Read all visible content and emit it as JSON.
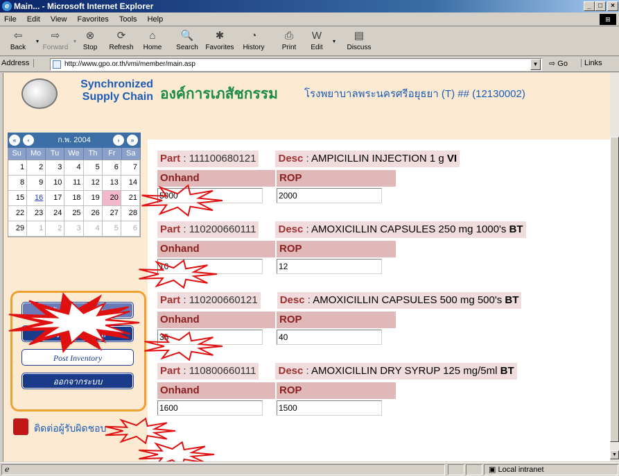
{
  "window": {
    "title": "Main... - Microsoft Internet Explorer",
    "controls": [
      "_",
      "□",
      "×"
    ]
  },
  "menubar": [
    "File",
    "Edit",
    "View",
    "Favorites",
    "Tools",
    "Help"
  ],
  "toolbar": [
    {
      "label": "Back",
      "icon": "back-arrow-icon",
      "glyph": "⇦"
    },
    {
      "label": "Forward",
      "icon": "forward-arrow-icon",
      "glyph": "⇨"
    },
    {
      "label": "Stop",
      "icon": "stop-icon",
      "glyph": "⊗"
    },
    {
      "label": "Refresh",
      "icon": "refresh-icon",
      "glyph": "⟳"
    },
    {
      "label": "Home",
      "icon": "home-icon",
      "glyph": "⌂"
    },
    {
      "label": "Search",
      "icon": "search-icon",
      "glyph": "🔍"
    },
    {
      "label": "Favorites",
      "icon": "favorites-icon",
      "glyph": "✱"
    },
    {
      "label": "History",
      "icon": "history-icon",
      "glyph": "◔"
    },
    {
      "label": "Print",
      "icon": "print-icon",
      "glyph": "⎙"
    },
    {
      "label": "Edit",
      "icon": "edit-icon",
      "glyph": "W"
    },
    {
      "label": "Discuss",
      "icon": "discuss-icon",
      "glyph": "▤"
    }
  ],
  "address": {
    "label": "Address",
    "url": "http://www.gpo.or.th/vmi/member/main.asp",
    "go": "Go",
    "links": "Links"
  },
  "header": {
    "logo_line1": "Synchronized",
    "logo_line2": "Supply Chain",
    "org": "องค์การเภสัชกรรม",
    "hospital": "โรงพยาบาลพระนครศรีอยุธยา (T) ## (12130002)"
  },
  "calendar": {
    "month_label": "ก.พ. 2004",
    "day_headers": [
      "Su",
      "Mo",
      "Tu",
      "We",
      "Th",
      "Fr",
      "Sa"
    ],
    "days": [
      "1",
      "2",
      "3",
      "4",
      "5",
      "6",
      "7",
      "8",
      "9",
      "10",
      "11",
      "12",
      "13",
      "14",
      "15",
      "16",
      "17",
      "18",
      "19",
      "20",
      "21",
      "22",
      "23",
      "24",
      "25",
      "26",
      "27",
      "28",
      "29",
      "1",
      "2",
      "3",
      "4",
      "5",
      "6"
    ],
    "today": "16",
    "highlight": "20"
  },
  "menu": {
    "items": [
      {
        "label": "บันทึก Inventory"
      },
      {
        "label": "ตรวจสอบข้อมูล"
      },
      {
        "label": "Post Inventory"
      },
      {
        "label": "ออกจากระบบ"
      }
    ]
  },
  "contact": "ติดต่อผู้รับผิดชอบ",
  "labels": {
    "part": "Part",
    "desc": "Desc",
    "onhand": "Onhand",
    "rop": "ROP"
  },
  "parts": [
    {
      "part": "111100680121",
      "desc": "AMPICILLIN INJECTION 1 g",
      "unit": "VI",
      "onhand": "5000",
      "rop": "2000"
    },
    {
      "part": "110200660111",
      "desc": "AMOXICILLIN CAPSULES 250 mg 1000's",
      "unit": "BT",
      "onhand": "10",
      "rop": "12"
    },
    {
      "part": "110200660121",
      "desc": "AMOXICILLIN CAPSULES 500 mg 500's",
      "unit": "BT",
      "onhand": "35",
      "rop": "40"
    },
    {
      "part": "110800660111",
      "desc": "AMOXICILLIN DRY SYRUP 125 mg/5ml",
      "unit": "BT",
      "onhand": "1600",
      "rop": "1500"
    }
  ],
  "status": {
    "zone": "Local intranet"
  },
  "colors": {
    "accent_blue": "#1a5ab8",
    "org_green": "#1a8a4a",
    "header_bg": "#fcebd2",
    "burst_red": "#e01010"
  }
}
